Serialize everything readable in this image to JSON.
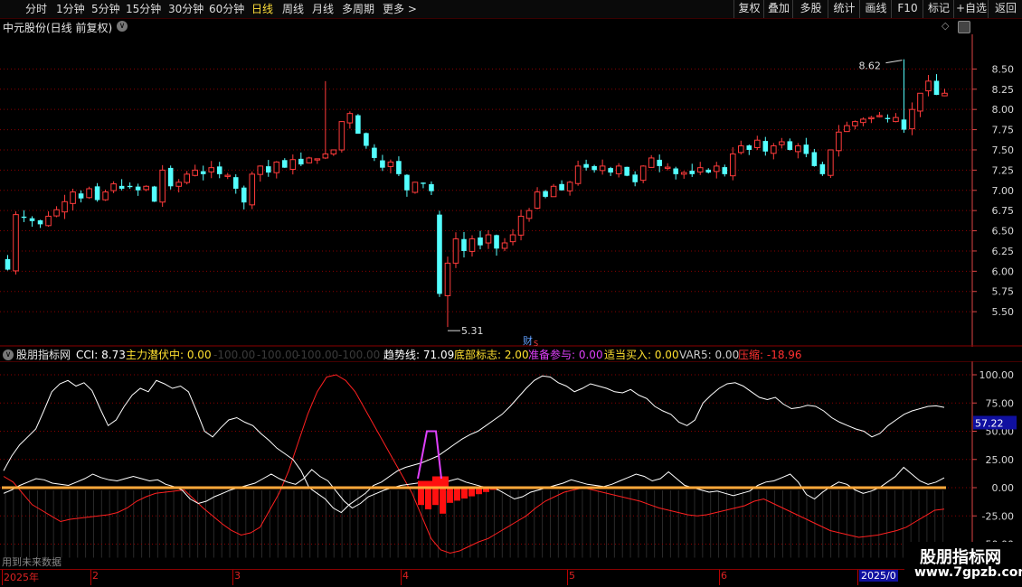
{
  "toolbar": {
    "left_items": [
      "分时",
      "1分钟",
      "5分钟",
      "15分钟",
      "30分钟",
      "60分钟",
      "日线",
      "周线",
      "月线",
      "多周期",
      "更多 >"
    ],
    "active_item": "日线",
    "right_items": [
      "复权",
      "叠加",
      "多股",
      "统计",
      "画线",
      "F10",
      "标记",
      "+自选",
      "返回"
    ]
  },
  "main_chart": {
    "title": "中元股份(日线 前复权)",
    "high_label": "8.62",
    "low_label": "5.31",
    "event_label": "财",
    "event_label2": "S"
  },
  "indicator": {
    "name": "股朋指标网",
    "cci_label": "CCI: 8.73",
    "main_label": "主力潜伏中: 0.00",
    "dim_labels": [
      "-100.00",
      "-100.00",
      "-100.00",
      "-100.00"
    ],
    "trend_label": "趋势线: 71.09",
    "bottom_label": "底部标志: 2.00",
    "prepare_label": "准备参与: 0.00",
    "buy_label": "适当买入: 0.00",
    "var5_label": "VAR5: 0.00",
    "squeeze_label": "压缩: -18.96",
    "current_value": "57.22",
    "future_data_note": "用到未来数据"
  },
  "date_axis": {
    "labels": [
      "2025年",
      "2",
      "3",
      "4",
      "5",
      "6",
      "2025/0"
    ]
  },
  "watermark": {
    "title": "股朋指标网",
    "url": "www.7gpzb.com"
  },
  "colors": {
    "up": "#ff3b3b",
    "down": "#54ffff",
    "grid": "#8a0000",
    "axis_text": "#d44",
    "white_line": "#ffffff",
    "red_line": "#ff2020",
    "orange_line": "#ffa83a",
    "magenta": "#e040fb"
  },
  "chart_data": [
    {
      "type": "candlestick",
      "y_ticks": [
        5.5,
        5.75,
        6.0,
        6.25,
        6.5,
        6.75,
        7.0,
        7.25,
        7.5,
        7.75,
        8.0,
        8.25,
        8.5
      ],
      "ylim": [
        5.2,
        8.75
      ],
      "high": 8.62,
      "low": 5.31,
      "closes": [
        6.02,
        6.7,
        6.66,
        6.62,
        6.58,
        6.68,
        6.76,
        6.86,
        6.98,
        6.9,
        7.02,
        6.88,
        6.98,
        7.08,
        7.02,
        7.04,
        7.0,
        7.05,
        6.86,
        7.25,
        7.05,
        7.1,
        7.2,
        7.25,
        7.2,
        7.28,
        7.2,
        7.18,
        7.02,
        6.85,
        7.2,
        7.3,
        7.22,
        7.35,
        7.28,
        7.38,
        7.32,
        7.4,
        7.38,
        7.45,
        7.5,
        7.85,
        7.95,
        7.7,
        7.55,
        7.4,
        7.28,
        7.35,
        7.2,
        7.0,
        7.1,
        7.08,
        6.99,
        5.72,
        6.1,
        6.4,
        6.25,
        6.4,
        6.32,
        6.45,
        6.28,
        6.35,
        6.45,
        6.68,
        6.75,
        6.98,
        6.92,
        7.05,
        7.0,
        7.1,
        7.3,
        7.28,
        7.25,
        7.3,
        7.22,
        7.3,
        7.18,
        7.1,
        7.3,
        7.4,
        7.3,
        7.28,
        7.2,
        7.22,
        7.2,
        7.28,
        7.22,
        7.3,
        7.2,
        7.45,
        7.55,
        7.5,
        7.62,
        7.48,
        7.55,
        7.6,
        7.5,
        7.55,
        7.45,
        7.3,
        7.2,
        7.5,
        7.72,
        7.8,
        7.85,
        7.88,
        7.9,
        7.92,
        7.88,
        7.9,
        7.75,
        8.0,
        8.2,
        8.35,
        8.18,
        8.2
      ]
    },
    {
      "type": "line",
      "y_ticks": [
        100,
        75,
        50,
        25,
        0,
        -25,
        -50
      ],
      "ylim": [
        -72,
        112
      ],
      "current_value": 57.22,
      "series": [
        {
          "name": "趋势线",
          "values": [
            15,
            28,
            38,
            45,
            52,
            68,
            85,
            92,
            95,
            90,
            93,
            86,
            70,
            55,
            60,
            72,
            82,
            88,
            85,
            95,
            92,
            88,
            90,
            85,
            68,
            50,
            45,
            53,
            60,
            62,
            58,
            55,
            48,
            42,
            35,
            30,
            25,
            15,
            0,
            -5,
            -10,
            -18,
            -22,
            -15,
            -10,
            -5,
            2,
            5,
            10,
            15,
            18,
            20,
            22,
            25,
            28,
            33,
            38,
            43,
            47,
            50,
            55,
            60,
            65,
            72,
            80,
            88,
            95,
            99,
            98,
            93,
            90,
            85,
            88,
            92,
            90,
            88,
            85,
            84,
            87,
            82,
            79,
            72,
            68,
            65,
            58,
            55,
            60,
            75,
            82,
            88,
            92,
            93,
            90,
            85,
            80,
            78,
            80,
            74,
            70,
            71,
            73,
            72,
            68,
            62,
            58,
            55,
            52,
            50,
            45,
            48,
            55,
            60,
            65,
            68,
            70,
            72,
            72.5,
            71.09
          ]
        },
        {
          "name": "CCI",
          "values": [
            -5,
            -2,
            2,
            5,
            8,
            7,
            4,
            3,
            2,
            5,
            8,
            12,
            9,
            7,
            6,
            8,
            10,
            8,
            6,
            7,
            3,
            1,
            -2,
            -10,
            -14,
            -12,
            -8,
            -5,
            -2,
            0,
            2,
            4,
            8,
            12,
            8,
            5,
            3,
            8,
            16,
            10,
            6,
            -3,
            -12,
            -18,
            -14,
            -8,
            -5,
            -2,
            0,
            2,
            3,
            4,
            5,
            4,
            2,
            6,
            8,
            5,
            3,
            1,
            0,
            -2,
            -6,
            -10,
            -8,
            -4,
            -2,
            0,
            2,
            4,
            7,
            5,
            3,
            2,
            1,
            3,
            6,
            9,
            12,
            10,
            6,
            8,
            14,
            8,
            2,
            0,
            -2,
            -4,
            -3,
            -5,
            -7,
            -5,
            -3,
            2,
            5,
            6,
            9,
            12,
            5,
            -6,
            -10,
            -4,
            1,
            5,
            3,
            -2,
            -5,
            -3,
            0,
            5,
            10,
            18,
            12,
            6,
            3,
            5,
            8.73
          ]
        },
        {
          "name": "压缩",
          "values": [
            10,
            5,
            -5,
            -15,
            -20,
            -25,
            -30,
            -28,
            -27,
            -26,
            -25,
            -24,
            -22,
            -18,
            -12,
            -8,
            -5,
            -4,
            -3,
            -2,
            -10,
            -18,
            -25,
            -32,
            -38,
            -42,
            -40,
            -35,
            -20,
            -5,
            15,
            40,
            65,
            85,
            98,
            100,
            95,
            85,
            70,
            55,
            40,
            25,
            10,
            -5,
            -25,
            -45,
            -55,
            -58,
            -56,
            -52,
            -48,
            -45,
            -40,
            -35,
            -30,
            -25,
            -18,
            -12,
            -8,
            -4,
            -2,
            0,
            -2,
            -4,
            -6,
            -8,
            -10,
            -12,
            -15,
            -18,
            -20,
            -22,
            -24,
            -25,
            -24,
            -22,
            -20,
            -18,
            -16,
            -12,
            -10,
            -14,
            -18,
            -22,
            -26,
            -30,
            -34,
            -38,
            -40,
            -42,
            -44,
            -43,
            -42,
            -40,
            -38,
            -35,
            -30,
            -25,
            -20,
            -18.96
          ]
        },
        {
          "name": "主力潜伏中",
          "values": [
            0
          ]
        },
        {
          "name": "VAR5",
          "values": [
            0
          ]
        }
      ]
    }
  ]
}
